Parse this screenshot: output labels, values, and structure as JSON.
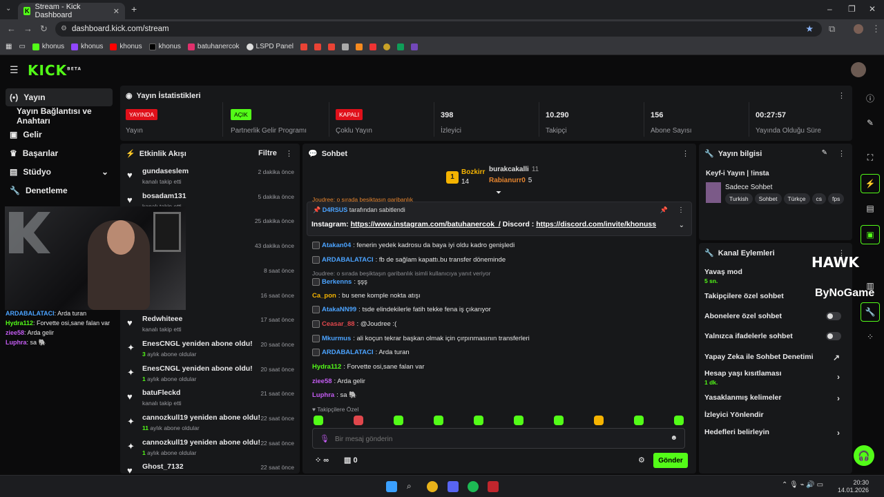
{
  "browser": {
    "tab_title": "Stream - Kick Dashboard",
    "url": "dashboard.kick.com/stream",
    "bookmarks": [
      "khonus",
      "khonus",
      "khonus",
      "khonus",
      "batuhanercok",
      "LSPD Panel"
    ]
  },
  "brand": {
    "logo": "KICK",
    "beta": "BETA",
    "accent": "#53fc18"
  },
  "sidebar": {
    "items": [
      {
        "label": "Yayın",
        "icon": "broadcast-icon"
      },
      {
        "label": "Yayın Bağlantısı ve Anahtarı"
      },
      {
        "label": "Gelir",
        "icon": "wallet-icon"
      },
      {
        "label": "Başarılar",
        "icon": "trophy-icon"
      },
      {
        "label": "Stüdyo",
        "icon": "studio-icon"
      },
      {
        "label": "Denetleme",
        "icon": "wrench-icon"
      }
    ]
  },
  "stats": {
    "title": "Yayın İstatistikleri",
    "items": [
      {
        "badge": "YAYINDA",
        "label": "Yayın"
      },
      {
        "badge": "AÇIK",
        "label": "Partnerlik Gelir Programı"
      },
      {
        "badge": "KAPALI",
        "label": "Çoklu Yayın"
      },
      {
        "value": "398",
        "label": "İzleyici"
      },
      {
        "value": "10.290",
        "label": "Takipçi"
      },
      {
        "value": "156",
        "label": "Abone Sayısı"
      },
      {
        "value": "00:27:57",
        "label": "Yayında Olduğu Süre"
      }
    ]
  },
  "events": {
    "title": "Etkinlik Akışı",
    "filter": "Filtre",
    "items": [
      {
        "name": "gundaseslem",
        "sub": "kanalı takip etti",
        "time": "2 dakika önce"
      },
      {
        "name": "bosadam131",
        "sub": "kanalı takip etti",
        "time": "5 dakika önce"
      },
      {
        "name": "",
        "sub": "",
        "time": "25 dakika önce"
      },
      {
        "name": "",
        "sub": "",
        "time": "43 dakika önce"
      },
      {
        "name": "",
        "sub": "",
        "time": "8 saat önce"
      },
      {
        "name": "",
        "sub": "",
        "time": "16 saat önce"
      },
      {
        "name": "Redwhiteee",
        "sub": "kanalı takip etti",
        "time": "17 saat önce"
      },
      {
        "name": "EnesCNGL yeniden abone oldu!",
        "count": "3",
        "sub": "aylık abone oldular",
        "time": "20 saat önce"
      },
      {
        "name": "EnesCNGL yeniden abone oldu!",
        "count": "1",
        "sub": "aylık abone oldular",
        "time": "20 saat önce"
      },
      {
        "name": "batuFleckd",
        "sub": "kanalı takip etti",
        "time": "21 saat önce"
      },
      {
        "name": "cannozkull19 yeniden abone oldu!",
        "count": "11",
        "sub": "aylık abone oldular",
        "time": "22 saat önce"
      },
      {
        "name": "cannozkull19 yeniden abone oldu!",
        "count": "1",
        "sub": "aylık abone oldular",
        "time": "22 saat önce"
      },
      {
        "name": "Ghost_7132",
        "sub": "",
        "time": "22 saat önce"
      }
    ]
  },
  "chat": {
    "title": "Sohbet",
    "leaders": [
      {
        "name": "Bozkirr",
        "count": "14"
      },
      {
        "name": "burakcakalli",
        "count": "11"
      },
      {
        "name": "Rabianurr0",
        "count": "5"
      }
    ],
    "first_rank": "1",
    "cut_line": "Joudree: o sırada beşiktaşın garibanlık",
    "pinned": {
      "by": "D4RSUS",
      "by_suffix": "tarafından sabitlendi",
      "prefix1": "Instagram:",
      "link1": "https://www.instagram.com/batuhanercok_/",
      "prefix2": "Discord :",
      "link2": "https://discord.com/invite/khonuss"
    },
    "messages": [
      {
        "user": "Atakan04",
        "color": "#4ba3ff",
        "text": ": fenerin yedek kadrosu da baya iyi oldu kadro genişledi"
      },
      {
        "user": "ARDABALATACI",
        "color": "#4ba3ff",
        "text": ": fb de sağlam kapattı.bu transfer döneminde"
      },
      {
        "reply": "Joudree: o sırada beşiktaşın garibanlık isimli kullanıcıya yanıt veriyor"
      },
      {
        "user": "Berkenns",
        "color": "#4ba3ff",
        "text": ": şşş"
      },
      {
        "user": "Ca_pon",
        "color": "#f5b301",
        "text": ": bu sene komple nokta atışı"
      },
      {
        "user": "AtakaNN99",
        "color": "#4ba3ff",
        "text": ": tsde elindekilerle fatih tekke fena iş çıkarıyor"
      },
      {
        "user": "Ceasar_88",
        "color": "#e0474c",
        "text": ": @Joudree :("
      },
      {
        "user": "Mkurmus",
        "color": "#4ba3ff",
        "text": ": ali koçun tekrar başkan olmak için çırpınmasının transferleri"
      },
      {
        "user": "ARDABALATACI",
        "color": "#4ba3ff",
        "text": ": Arda turan"
      },
      {
        "user": "Hydra112",
        "color": "#53fc18",
        "text": ": Forvette osi,sane falan var"
      },
      {
        "user": "ziee58",
        "color": "#c45cf3",
        "text": ": Arda gelir"
      },
      {
        "user": "Luphra",
        "color": "#c45cf3",
        "text": ": sa 🐘"
      }
    ],
    "followers_only": "Takipçilere Özel",
    "input_placeholder": "Bir mesaj gönderin",
    "footer_points": "∞",
    "footer_gifts": "0",
    "send": "Gönder"
  },
  "info": {
    "title": "Yayın bilgisi",
    "stream_title": "Keyf-i Yayın | !insta",
    "category": "Sadece Sohbet",
    "tags": [
      "Turkish",
      "Sohbet",
      "Türkçe",
      "cs",
      "fps"
    ]
  },
  "actions": {
    "title": "Kanal Eylemleri",
    "slow_mode": "Yavaş mod",
    "slow_value": "5 sn.",
    "followers_chat": "Takipçilere özel sohbet",
    "subs_chat": "Abonelere özel sohbet",
    "emote_chat": "Yalnızca ifadelerle sohbet",
    "ai_mod": "Yapay Zeka ile Sohbet Denetimi",
    "age_limit": "Hesap yaşı kısıtlaması",
    "age_value": "1 dk.",
    "banned_words": "Yasaklanmış kelimeler",
    "redirect": "İzleyici Yönlendir",
    "goals": "Hedefleri belirleyin"
  },
  "overlay": {
    "chat": [
      {
        "user": "ARDABALATACI",
        "color": "#4ba3ff",
        "text": ": Arda turan"
      },
      {
        "user": "Hydra112",
        "color": "#53fc18",
        "text": ": Forvette osi,sane falan var"
      },
      {
        "user": "ziee58",
        "color": "#c45cf3",
        "text": ": Arda gelir"
      },
      {
        "user": "Luphra",
        "color": "#c45cf3",
        "text": ": sa 🐘"
      }
    ],
    "sponsor1": "HAWK",
    "sponsor2": "ByNoGame"
  },
  "taskbar": {
    "time": "20:30",
    "date": "14.01.2026"
  }
}
